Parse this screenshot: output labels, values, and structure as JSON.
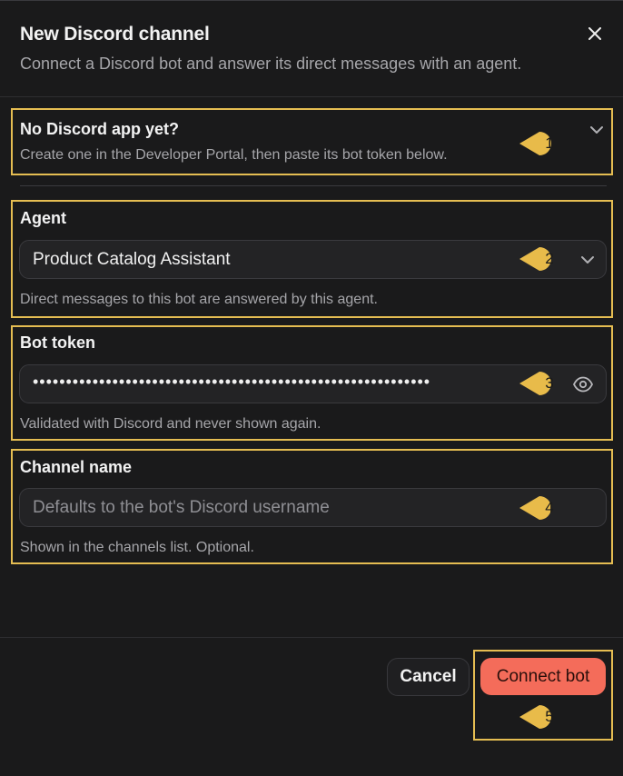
{
  "dialog": {
    "title": "New Discord channel",
    "subtitle": "Connect a Discord bot and answer its direct messages with an agent."
  },
  "setup_help": {
    "title": "No Discord app yet?",
    "description": "Create one in the Developer Portal, then paste its bot token below.",
    "icon": "chevron-down-icon"
  },
  "agent_field": {
    "label": "Agent",
    "selected_value": "Product Catalog Assistant",
    "hint": "Direct messages to this bot are answered by this agent."
  },
  "bot_token_field": {
    "label": "Bot token",
    "masked_value": "••••••••••••••••••••••••••••••••••••••••••••••••••••••••••••",
    "hint": "Validated with Discord and never shown again.",
    "icon": "eye-icon"
  },
  "channel_name_field": {
    "label": "Channel name",
    "placeholder": "Defaults to the bot's Discord username",
    "hint": "Shown in the channels list. Optional."
  },
  "footer": {
    "cancel_label": "Cancel",
    "connect_label": "Connect bot"
  },
  "markers": [
    "1",
    "2",
    "3",
    "4",
    "5"
  ],
  "colors": {
    "background": "#1a1a1b",
    "highlight_outline": "#e5bd52",
    "marker_fill": "#e8bb4a",
    "primary_button": "#f46c5a"
  }
}
